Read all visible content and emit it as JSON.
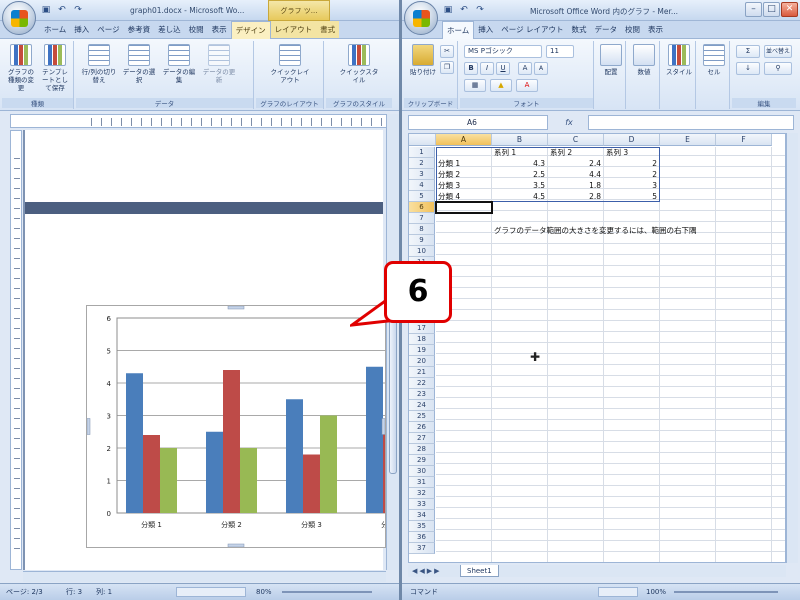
{
  "word": {
    "title": "graph01.docx - Microsoft Wo...",
    "context_tab_group": "グラフ ツ...",
    "tabs": [
      {
        "label": "ホーム",
        "active": false,
        "contextual": false
      },
      {
        "label": "挿入",
        "active": false,
        "contextual": false
      },
      {
        "label": "ページ",
        "active": false,
        "contextual": false
      },
      {
        "label": "参考資",
        "active": false,
        "contextual": false
      },
      {
        "label": "差し込",
        "active": false,
        "contextual": false
      },
      {
        "label": "校閲",
        "active": false,
        "contextual": false
      },
      {
        "label": "表示",
        "active": false,
        "contextual": false
      },
      {
        "label": "デザイン",
        "active": true,
        "contextual": true
      },
      {
        "label": "レイアウト",
        "active": false,
        "contextual": true
      },
      {
        "label": "書式",
        "active": false,
        "contextual": true
      }
    ],
    "ribbon": {
      "groups": [
        {
          "label": "種類",
          "buttons": [
            "グラフの種類の変更",
            "テンプレートとして保存"
          ]
        },
        {
          "label": "データ",
          "buttons": [
            "行/列の切り替え",
            "データの選択",
            "データの編集",
            "データの更新"
          ]
        },
        {
          "label": "グラフのレイアウト",
          "buttons": [
            "クイックレイアウト"
          ]
        },
        {
          "label": "グラフのスタイル",
          "buttons": [
            "クイックスタイル"
          ]
        }
      ]
    },
    "status": {
      "page": "ページ: 2/3",
      "section": "行: 3",
      "words": "列: 1",
      "zoom": "80%"
    }
  },
  "excel": {
    "title": "Microsoft Office Word 内のグラフ - Mer...",
    "tabs": [
      {
        "label": "ホーム",
        "active": true
      },
      {
        "label": "挿入",
        "active": false
      },
      {
        "label": "ページ レイアウト",
        "active": false
      },
      {
        "label": "数式",
        "active": false
      },
      {
        "label": "データ",
        "active": false
      },
      {
        "label": "校閲",
        "active": false
      },
      {
        "label": "表示",
        "active": false
      }
    ],
    "ribbon": {
      "font_name": "MS Pゴシック",
      "font_size": "11",
      "groups": [
        {
          "label": "クリップボード",
          "buttons": [
            "貼り付け"
          ]
        },
        {
          "label": "フォント",
          "buttons": [
            "B",
            "I",
            "U",
            "A",
            "A"
          ]
        },
        {
          "label": "配置",
          "buttons": [
            "配置"
          ]
        },
        {
          "label": "数値",
          "buttons": [
            "数値"
          ]
        },
        {
          "label": "スタイル",
          "buttons": [
            "スタイル"
          ]
        },
        {
          "label": "セル",
          "buttons": [
            "セル"
          ]
        },
        {
          "label": "編集",
          "buttons": [
            "Σ",
            "並べ替え"
          ]
        }
      ]
    },
    "name_box": "A6",
    "fx_label": "fx",
    "formula": "",
    "columns": [
      "A",
      "B",
      "C",
      "D",
      "E",
      "F"
    ],
    "selected_column": "A",
    "rows": [
      "1",
      "2",
      "3",
      "4",
      "5",
      "6",
      "7",
      "8",
      "9",
      "10",
      "11",
      "12",
      "13",
      "14",
      "15",
      "16",
      "17",
      "18",
      "19",
      "20",
      "21",
      "22",
      "23",
      "24",
      "25",
      "26",
      "27",
      "28",
      "29",
      "30",
      "31",
      "32",
      "33",
      "34",
      "35",
      "36",
      "37"
    ],
    "selected_row": "6",
    "headers": [
      "系列 1",
      "系列 2",
      "系列 3"
    ],
    "data_rows": [
      {
        "category": "分類 1",
        "values": [
          "4.3",
          "2.4",
          "2"
        ]
      },
      {
        "category": "分類 2",
        "values": [
          "2.5",
          "4.4",
          "2"
        ]
      },
      {
        "category": "分類 3",
        "values": [
          "3.5",
          "1.8",
          "3"
        ]
      },
      {
        "category": "分類 4",
        "values": [
          "4.5",
          "2.8",
          "5"
        ]
      }
    ],
    "note": "グラフのデータ範囲の大きさを変更するには、範囲の右下隅",
    "sheet_tab": "Sheet1",
    "status": {
      "mode": "コマンド",
      "zoom": "100%"
    }
  },
  "callout": {
    "number": "6"
  },
  "chart_data": {
    "type": "bar",
    "categories": [
      "分類 1",
      "分類 2",
      "分類 3",
      "分類 4"
    ],
    "series": [
      {
        "name": "系列 1",
        "color": "#4a7ebb",
        "values": [
          4.3,
          2.5,
          3.5,
          4.5
        ]
      },
      {
        "name": "系列 2",
        "color": "#be4b48",
        "values": [
          2.4,
          4.4,
          1.8,
          2.8
        ]
      },
      {
        "name": "系列 3",
        "color": "#98b954",
        "values": [
          2,
          2,
          3,
          5
        ]
      }
    ],
    "ylim": [
      0,
      6
    ],
    "yticks": [
      0,
      1,
      2,
      3,
      4,
      5,
      6
    ],
    "grid": true
  }
}
